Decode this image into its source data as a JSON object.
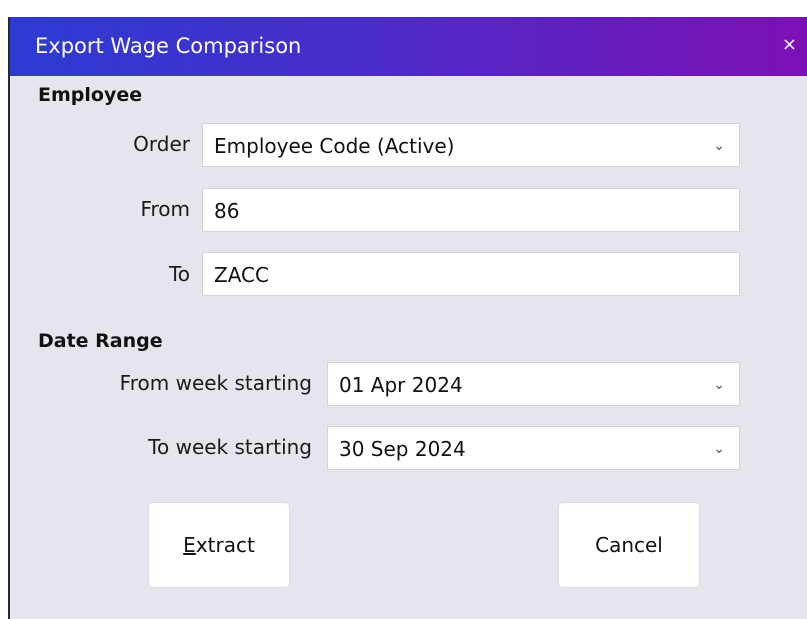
{
  "window": {
    "title": "Export Wage Comparison",
    "close_glyph": "×"
  },
  "employee": {
    "heading": "Employee",
    "order_label": "Order",
    "order_value": "Employee Code (Active)",
    "from_label": "From",
    "from_value": "86",
    "to_label": "To",
    "to_value": "ZACC"
  },
  "date_range": {
    "heading": "Date Range",
    "from_label": "From week starting",
    "from_value": "01 Apr 2024",
    "to_label": "To week starting",
    "to_value": "30 Sep 2024"
  },
  "buttons": {
    "extract_mnemonic": "E",
    "extract_rest": "xtract",
    "cancel": "Cancel"
  },
  "icons": {
    "dropdown": "chevron-down-icon",
    "close": "close-icon"
  },
  "colors": {
    "titlebar_start": "#2c3bd3",
    "titlebar_end": "#7d10b5",
    "body_bg": "#e6e5ee",
    "field_bg": "#ffffff"
  }
}
